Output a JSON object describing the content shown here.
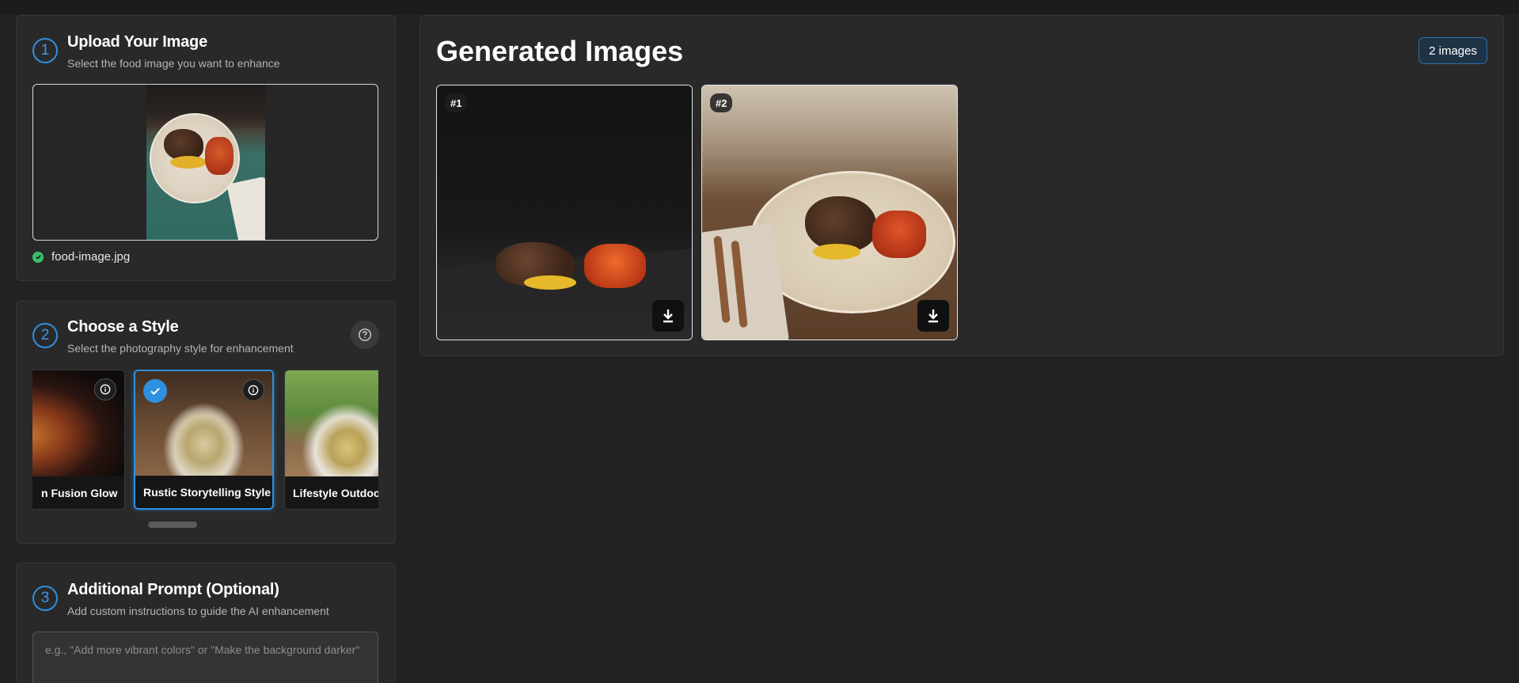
{
  "upload": {
    "step": "1",
    "title": "Upload Your Image",
    "subtitle": "Select the food image you want to enhance",
    "file_name": "food-image.jpg"
  },
  "style": {
    "step": "2",
    "title": "Choose a Style",
    "subtitle": "Select the photography style for enhancement",
    "cards": [
      {
        "label": "n Fusion Glow",
        "selected": false
      },
      {
        "label": "Rustic Storytelling Style",
        "selected": true
      },
      {
        "label": "Lifestyle Outdoo",
        "selected": false
      }
    ]
  },
  "prompt": {
    "step": "3",
    "title": "Additional Prompt (Optional)",
    "subtitle": "Add custom instructions to guide the AI enhancement",
    "placeholder": "e.g., \"Add more vibrant colors\" or \"Make the background darker\""
  },
  "results": {
    "title": "Generated Images",
    "count_label": "2 images",
    "images": [
      {
        "number": "#1"
      },
      {
        "number": "#2"
      }
    ]
  },
  "icons": {
    "check": "check-circle-icon",
    "help": "question-circle-icon",
    "info": "info-icon",
    "download": "download-icon"
  },
  "colors": {
    "accent": "#2f8fe0",
    "success": "#36c06a",
    "background": "#222222",
    "card": "#292929"
  }
}
